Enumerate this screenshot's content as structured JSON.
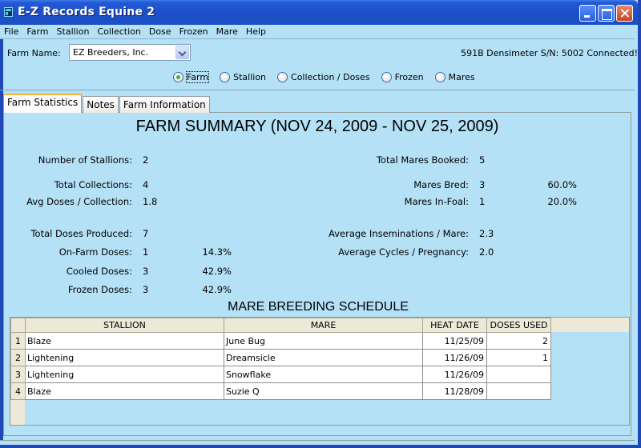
{
  "window": {
    "title": "E-Z Records Equine 2",
    "icon": "app-icon",
    "controls": [
      "minimize-icon",
      "maximize-icon",
      "close-icon"
    ]
  },
  "menu": [
    "File",
    "Farm",
    "Stallion",
    "Collection",
    "Dose",
    "Frozen",
    "Mare",
    "Help"
  ],
  "farm": {
    "label": "Farm Name:",
    "selected": "EZ Breeders, Inc."
  },
  "device_status": "591B Densimeter S/N: 5002 Connected!",
  "view_options": [
    {
      "label": "Farm",
      "selected": true
    },
    {
      "label": "Stallion",
      "selected": false
    },
    {
      "label": "Collection / Doses",
      "selected": false
    },
    {
      "label": "Frozen",
      "selected": false
    },
    {
      "label": "Mares",
      "selected": false
    }
  ],
  "tabs": [
    {
      "label": "Farm Statistics",
      "active": true
    },
    {
      "label": "Notes",
      "active": false
    },
    {
      "label": "Farm Information",
      "active": false
    }
  ],
  "summary": {
    "title": "FARM SUMMARY (NOV 24, 2009  -  NOV 25, 2009)",
    "left": [
      {
        "label": "Number of Stallions:",
        "value": "2",
        "pct": ""
      },
      {
        "label": "Total Collections:",
        "value": "4",
        "pct": ""
      },
      {
        "label": "Avg Doses / Collection:",
        "value": "1.8",
        "pct": ""
      },
      {
        "label": "Total Doses Produced:",
        "value": "7",
        "pct": ""
      },
      {
        "label": "On-Farm Doses:",
        "value": "1",
        "pct": "14.3%"
      },
      {
        "label": "Cooled Doses:",
        "value": "3",
        "pct": "42.9%"
      },
      {
        "label": "Frozen Doses:",
        "value": "3",
        "pct": "42.9%"
      }
    ],
    "right": [
      {
        "label": "Total Mares Booked:",
        "value": "5",
        "pct": ""
      },
      {
        "label": "Mares Bred:",
        "value": "3",
        "pct": "60.0%"
      },
      {
        "label": "Mares In-Foal:",
        "value": "1",
        "pct": "20.0%"
      },
      {
        "label": "Average Inseminations / Mare:",
        "value": "2.3",
        "pct": ""
      },
      {
        "label": "Average Cycles / Pregnancy:",
        "value": "2.0",
        "pct": ""
      }
    ]
  },
  "schedule": {
    "title": "MARE BREEDING SCHEDULE",
    "columns": [
      "STALLION",
      "MARE",
      "HEAT DATE",
      "DOSES USED"
    ],
    "rows": [
      {
        "n": "1",
        "stallion": "Blaze",
        "mare": "June Bug",
        "heat_date": "11/25/09",
        "doses_used": "2"
      },
      {
        "n": "2",
        "stallion": "Lightening",
        "mare": "Dreamsicle",
        "heat_date": "11/26/09",
        "doses_used": "1"
      },
      {
        "n": "3",
        "stallion": "Lightening",
        "mare": "Snowflake",
        "heat_date": "11/26/09",
        "doses_used": ""
      },
      {
        "n": "4",
        "stallion": "Blaze",
        "mare": "Suzie Q",
        "heat_date": "11/28/09",
        "doses_used": ""
      }
    ]
  }
}
